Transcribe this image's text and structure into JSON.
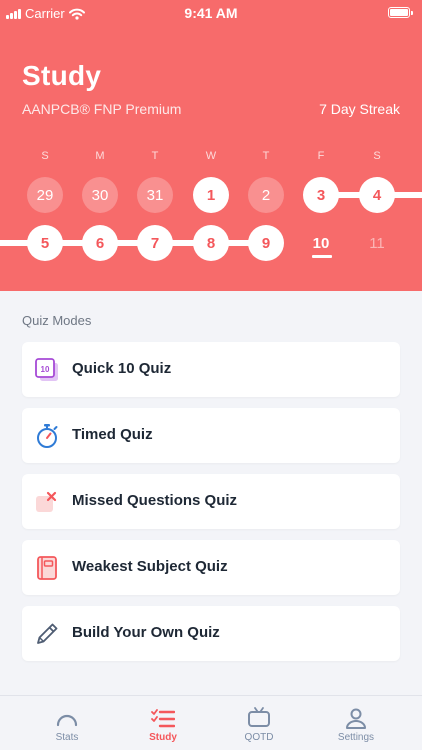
{
  "status_bar": {
    "carrier": "Carrier",
    "time": "9:41 AM"
  },
  "header": {
    "title": "Study",
    "subtitle": "AANPCB® FNP Premium",
    "streak": "7 Day Streak"
  },
  "calendar": {
    "weekdays": [
      "S",
      "M",
      "T",
      "W",
      "T",
      "F",
      "S"
    ],
    "week1": [
      {
        "day": "29",
        "state": "past"
      },
      {
        "day": "30",
        "state": "past"
      },
      {
        "day": "31",
        "state": "past"
      },
      {
        "day": "1",
        "state": "done"
      },
      {
        "day": "2",
        "state": "past"
      },
      {
        "day": "3",
        "state": "done"
      },
      {
        "day": "4",
        "state": "done"
      }
    ],
    "week2": [
      {
        "day": "5",
        "state": "done"
      },
      {
        "day": "6",
        "state": "done"
      },
      {
        "day": "7",
        "state": "done"
      },
      {
        "day": "8",
        "state": "done"
      },
      {
        "day": "9",
        "state": "done"
      },
      {
        "day": "10",
        "state": "today"
      },
      {
        "day": "11",
        "state": "future"
      }
    ]
  },
  "quiz_modes": {
    "title": "Quiz Modes",
    "items": [
      {
        "label": "Quick 10 Quiz",
        "icon": "quick-10-icon",
        "badge": "10"
      },
      {
        "label": "Timed Quiz",
        "icon": "stopwatch-icon"
      },
      {
        "label": "Missed Questions Quiz",
        "icon": "missed-x-icon"
      },
      {
        "label": "Weakest Subject Quiz",
        "icon": "notebook-icon"
      },
      {
        "label": "Build Your Own Quiz",
        "icon": "pencil-icon"
      }
    ]
  },
  "tab_bar": {
    "items": [
      {
        "label": "Stats",
        "icon": "gauge-icon",
        "active": false
      },
      {
        "label": "Study",
        "icon": "checklist-icon",
        "active": true
      },
      {
        "label": "QOTD",
        "icon": "tv-icon",
        "active": false
      },
      {
        "label": "Settings",
        "icon": "person-icon",
        "active": false
      }
    ]
  },
  "colors": {
    "accent": "#f76b6b",
    "accent_text": "#f4575b",
    "background": "#f3f4f8",
    "inactive_tab": "#7c8da6",
    "quick10_purple": "#a64ad6",
    "timer_blue": "#2f7bd6",
    "pencil_slate": "#4f5d73"
  }
}
